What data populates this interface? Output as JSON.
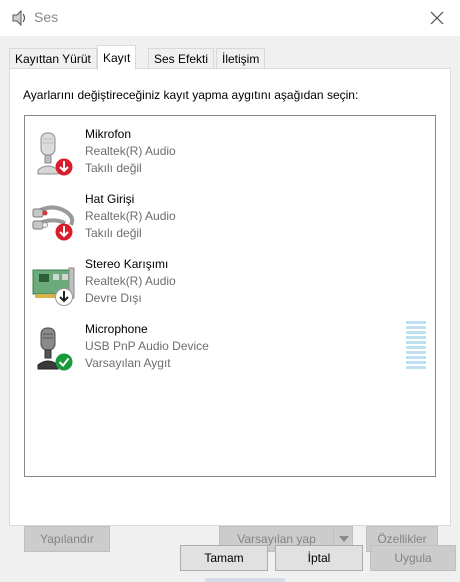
{
  "window": {
    "title": "Ses"
  },
  "tabs": [
    {
      "label": "Kayıttan Yürüt",
      "active": false
    },
    {
      "label": "Kayıt",
      "active": true
    },
    {
      "label": "Ses Efekti",
      "active": false
    },
    {
      "label": "İletişim",
      "active": false
    }
  ],
  "instruction": "Ayarlarını değiştireceğiniz kayıt yapma aygıtını aşağıdan seçin:",
  "devices": [
    {
      "name": "Mikrofon",
      "description": "Realtek(R) Audio",
      "state": "Takılı değil",
      "icon": "microphone-icon",
      "status_icon": "unplugged-red-arrow-icon"
    },
    {
      "name": "Hat Girişi",
      "description": "Realtek(R) Audio",
      "state": "Takılı değil",
      "icon": "line-in-cable-icon",
      "status_icon": "unplugged-red-arrow-icon"
    },
    {
      "name": "Stereo Karışımı",
      "description": "Realtek(R) Audio",
      "state": "Devre Dışı",
      "icon": "sound-card-icon",
      "status_icon": "disabled-arrow-icon"
    },
    {
      "name": "Microphone",
      "description": "USB PnP Audio Device",
      "state": "Varsayılan Aygıt",
      "icon": "usb-microphone-icon",
      "status_icon": "default-check-icon"
    }
  ],
  "buttons": {
    "configure": "Yapılandır",
    "set_default": "Varsayılan yap",
    "properties": "Özellikler",
    "ok": "Tamam",
    "cancel": "İptal",
    "apply": "Uygula"
  },
  "colors": {
    "disabled_button": "#cccccc",
    "meter": "#bfe0ef",
    "default_check": "#1a9a3a",
    "unplugged_arrow": "#d81e2c"
  }
}
